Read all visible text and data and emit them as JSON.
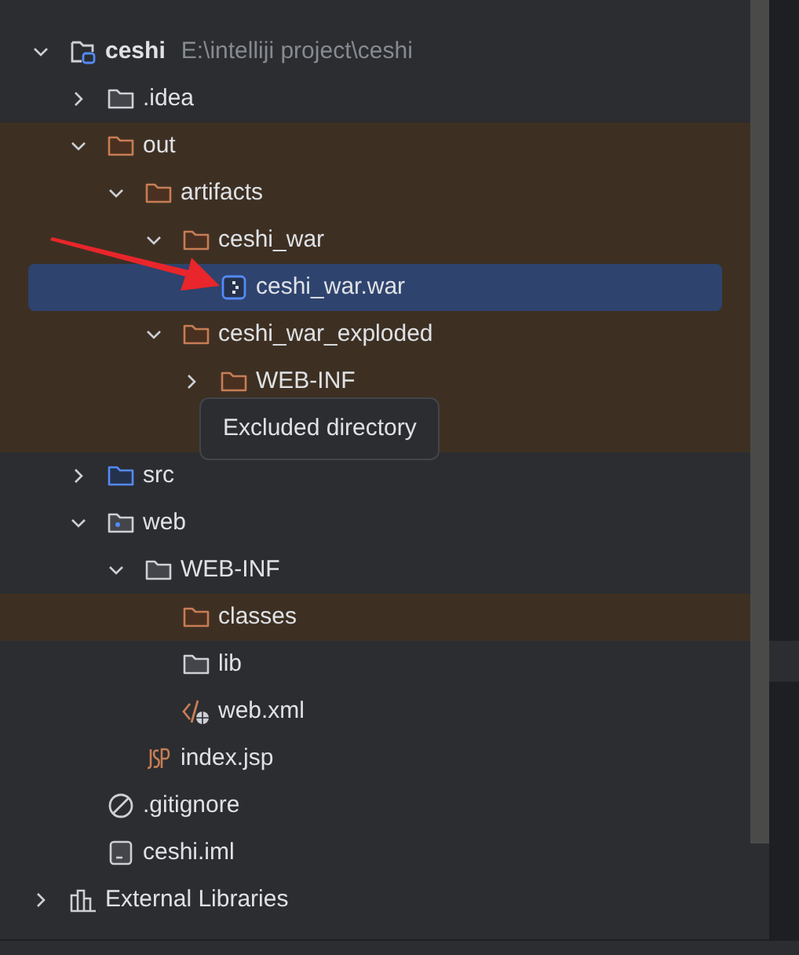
{
  "tree": [
    {
      "name": "ceshi",
      "kind": "project",
      "path": "E:\\intelliji project\\ceshi",
      "expanded": true,
      "excluded": false,
      "selected": false,
      "children": [
        {
          "name": ".idea",
          "kind": "folder",
          "expanded": false,
          "excluded": false,
          "selected": false
        },
        {
          "name": "out",
          "kind": "folder_excluded",
          "expanded": true,
          "excluded": true,
          "selected": false,
          "children": [
            {
              "name": "artifacts",
              "kind": "folder_excluded",
              "expanded": true,
              "excluded": true,
              "selected": false,
              "children": [
                {
                  "name": "ceshi_war",
                  "kind": "folder_excluded",
                  "expanded": true,
                  "excluded": true,
                  "selected": false,
                  "children": [
                    {
                      "name": "ceshi_war.war",
                      "kind": "archive",
                      "excluded": true,
                      "selected": true
                    }
                  ]
                },
                {
                  "name": "ceshi_war_exploded",
                  "kind": "folder_excluded",
                  "expanded": true,
                  "excluded": true,
                  "selected": false,
                  "children": [
                    {
                      "name": "WEB-INF",
                      "kind": "folder_excluded",
                      "expanded": false,
                      "excluded": true,
                      "selected": false
                    }
                  ]
                }
              ]
            }
          ]
        },
        {
          "name": "src",
          "kind": "folder_source",
          "expanded": false,
          "excluded": false,
          "selected": false
        },
        {
          "name": "web",
          "kind": "folder_web",
          "expanded": true,
          "excluded": false,
          "selected": false,
          "children": [
            {
              "name": "WEB-INF",
              "kind": "folder",
              "expanded": true,
              "excluded": false,
              "selected": false,
              "children": [
                {
                  "name": "classes",
                  "kind": "folder_excluded",
                  "excluded": true,
                  "selected": false
                },
                {
                  "name": "lib",
                  "kind": "folder",
                  "excluded": false,
                  "selected": false
                },
                {
                  "name": "web.xml",
                  "kind": "xml",
                  "excluded": false,
                  "selected": false
                }
              ]
            },
            {
              "name": "index.jsp",
              "kind": "jsp",
              "excluded": false,
              "selected": false
            }
          ]
        },
        {
          "name": ".gitignore",
          "kind": "ignore",
          "excluded": false,
          "selected": false
        },
        {
          "name": "ceshi.iml",
          "kind": "iml",
          "excluded": false,
          "selected": false
        }
      ]
    },
    {
      "name": "External Libraries",
      "kind": "library",
      "expanded": false,
      "excluded": false,
      "selected": false
    }
  ],
  "tooltip": {
    "text": "Excluded directory"
  }
}
